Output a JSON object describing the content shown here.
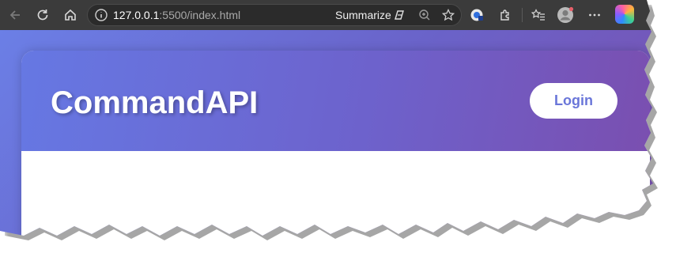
{
  "browser": {
    "url_host": "127.0.0.1",
    "url_rest": ":5500/index.html",
    "summarize_label": "Summarize",
    "icons": [
      "back-icon",
      "reload-icon",
      "home-icon",
      "info-icon",
      "summarize-icon",
      "zoom-icon",
      "favorite-star-icon",
      "extension-badge-icon",
      "extensions-icon",
      "favorites-icon",
      "profile-icon",
      "more-icon",
      "copilot-icon"
    ],
    "colors": {
      "toolbar": "#3b3b3b",
      "omnibox": "#2b2b2b"
    }
  },
  "page": {
    "brand": "CommandAPI",
    "login_label": "Login",
    "colors": {
      "gradient_start": "#6678e3",
      "gradient_end": "#7a4fb0",
      "button_text": "#6a76d9"
    }
  }
}
